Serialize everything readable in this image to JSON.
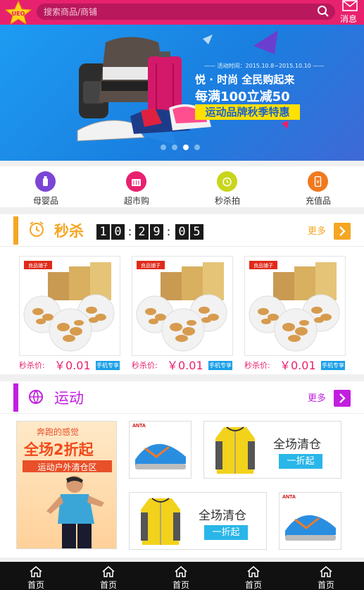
{
  "header": {
    "logo_text": "UEO",
    "search_placeholder": "搜索商品/商铺",
    "search_icon": "search-icon",
    "message_label": "消息",
    "message_icon": "envelope-icon"
  },
  "banner": {
    "date_text": "—— 活动时间：2015.10.8~2015.10.10 ——",
    "line1": "悦 · 时尚 全民购起来",
    "line2": "每满100立减50",
    "line3": "运动品牌秋季特惠",
    "dot_count": 4,
    "active_dot": 3
  },
  "categories": [
    {
      "label": "母婴品",
      "icon": "baby-bottle-icon",
      "color": "#7b45d6"
    },
    {
      "label": "超市购",
      "icon": "shopping-basket-icon",
      "color": "#e8216e"
    },
    {
      "label": "秒杀拍",
      "icon": "alarm-clock-icon",
      "color": "#c8d61b"
    },
    {
      "label": "充值品",
      "icon": "phone-recharge-icon",
      "color": "#f07a1e"
    }
  ],
  "flash_sale": {
    "title": "秒杀",
    "icon": "alarm-clock-icon",
    "accent_color": "#f5a623",
    "timer": [
      "1",
      "0",
      "2",
      "9",
      "0",
      "5"
    ],
    "more_label": "更多",
    "products": [
      {
        "brand": "良品铺子",
        "price_label": "秒杀价:",
        "price": "￥0.01",
        "tag": "手机专享"
      },
      {
        "brand": "良品铺子",
        "price_label": "秒杀价:",
        "price": "￥0.01",
        "tag": "手机专享"
      },
      {
        "brand": "良品铺子",
        "price_label": "秒杀价:",
        "price": "￥0.01",
        "tag": "手机专享"
      }
    ]
  },
  "sports": {
    "title": "运动",
    "icon": "basketball-icon",
    "accent_color": "#c21fe0",
    "more_label": "更多",
    "promo": {
      "line1": "奔跑的感觉",
      "line2": "全场2折起",
      "line3": "运动户外清仓区"
    },
    "jacket_tile_1": {
      "headline": "全场清仓",
      "cta": "一折起"
    },
    "jacket_tile_2": {
      "headline": "全场清仓",
      "cta": "一折起"
    },
    "shoe_brand": "ANTA"
  },
  "bottom_nav": [
    {
      "label": "首页",
      "icon": "home-icon"
    },
    {
      "label": "首页",
      "icon": "home-icon"
    },
    {
      "label": "首页",
      "icon": "home-icon"
    },
    {
      "label": "首页",
      "icon": "home-icon"
    },
    {
      "label": "首页",
      "icon": "home-icon"
    }
  ]
}
